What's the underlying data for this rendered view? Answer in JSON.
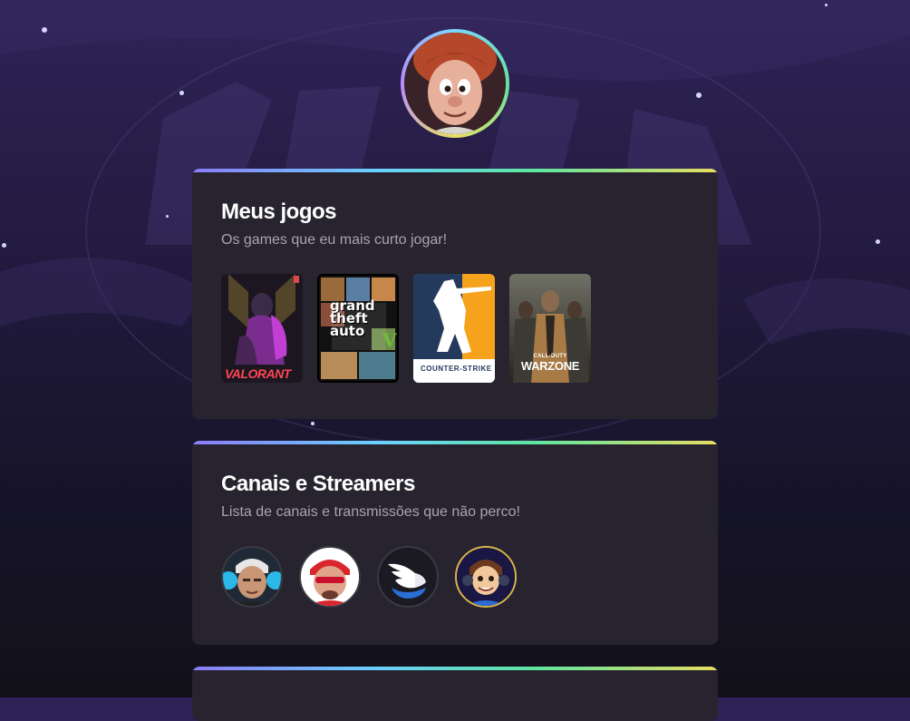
{
  "profile": {
    "avatar_icon": "profile-avatar-icon"
  },
  "sections": [
    {
      "title": "Meus jogos",
      "subtitle": "Os games que eu mais curto jogar!",
      "games": [
        {
          "name": "VALORANT",
          "icon": "valorant-cover-icon"
        },
        {
          "name": "Grand Theft Auto V",
          "logo_lines": [
            "grand",
            "theft",
            "auto"
          ],
          "numeral": "V",
          "icon": "gta-cover-icon"
        },
        {
          "name": "COUNTER-STRIKE",
          "icon": "counter-strike-cover-icon"
        },
        {
          "name": "Call of Duty Warzone",
          "logo_small": "CALL·DUTY",
          "logo_main": "WARZONE",
          "icon": "warzone-cover-icon"
        }
      ]
    },
    {
      "title": "Canais e Streamers",
      "subtitle": "Lista de canais e transmissões que não perco!",
      "channels": [
        {
          "icon": "streamer-1-avatar-icon"
        },
        {
          "icon": "streamer-2-avatar-icon"
        },
        {
          "icon": "wing-logo-channel-icon"
        },
        {
          "icon": "cartoon-streamer-avatar-icon"
        }
      ]
    }
  ],
  "colors": {
    "accent_gradient": [
      "#8b7cf6",
      "#6ad0ff",
      "#5ee6a0",
      "#e8dd60"
    ],
    "card_bg": "#28242f",
    "subtitle": "#a7a3b3"
  }
}
